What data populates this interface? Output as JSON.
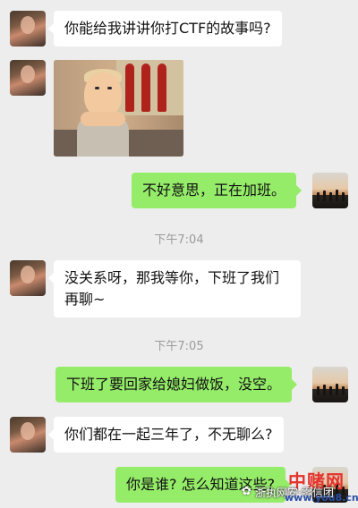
{
  "messages": [
    {
      "side": "left",
      "text": "你能给我讲讲你打CTF的故事吗?"
    },
    {
      "side": "left",
      "type": "image",
      "image_desc": "cartoon-image"
    },
    {
      "side": "right",
      "text": "不好意思，正在加班。"
    },
    {
      "side": "left",
      "text_line1": "没关系呀，那我等你，下班了我们",
      "text_line2": "再聊~"
    },
    {
      "side": "right",
      "text": "下班了要回家给媳妇做饭，没空。"
    },
    {
      "side": "left",
      "text": "你们都在一起三年了，不无聊么?"
    },
    {
      "side": "right",
      "text": "你是谁? 怎么知道这些?"
    }
  ],
  "timestamps": [
    "下午7:04",
    "下午7:05"
  ],
  "watermark": {
    "brand": "中赌网",
    "url": "www.you8.cn",
    "account": "浙执网安·零信团",
    "wechat_icon": "wechat-icon"
  },
  "colors": {
    "background": "#ededed",
    "incoming_bubble": "#ffffff",
    "outgoing_bubble": "#95ec69"
  }
}
